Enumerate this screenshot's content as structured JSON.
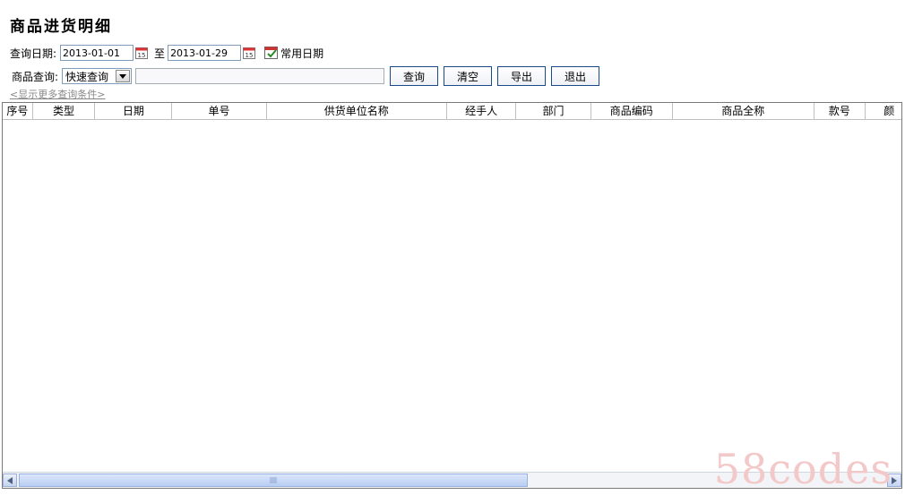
{
  "page": {
    "title": "商品进货明细"
  },
  "date_query": {
    "label": "查询日期:",
    "start": "2013-01-01",
    "separator": "至",
    "end": "2013-01-29",
    "common_dates": "常用日期"
  },
  "product_query": {
    "label": "商品查询:",
    "mode": "快速查询",
    "text": ""
  },
  "buttons": {
    "query": "查询",
    "clear": "清空",
    "export": "导出",
    "exit": "退出"
  },
  "more_link": "<显示更多查询条件>",
  "table": {
    "columns": [
      "序号",
      "类型",
      "日期",
      "单号",
      "供货单位名称",
      "经手人",
      "部门",
      "商品编码",
      "商品全称",
      "款号",
      "颜"
    ]
  },
  "watermark": "58codes"
}
